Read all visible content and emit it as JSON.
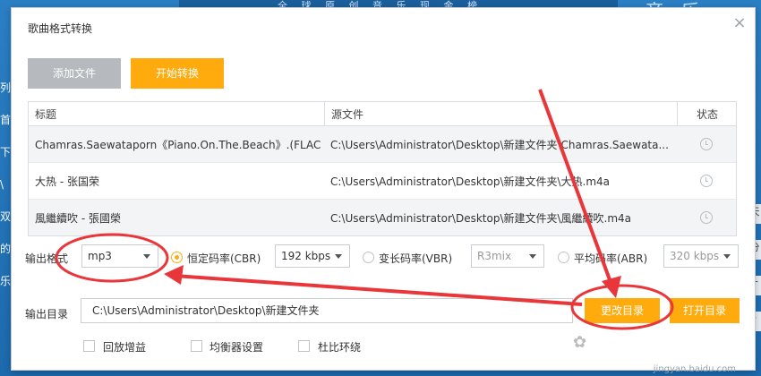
{
  "background": {
    "banner_text": "全 球 原 创 音 乐 现 金 榜",
    "brand_text": "音乐",
    "left_items": [
      "列",
      "首",
      "下",
      "\\",
      "双",
      "的",
      "乐"
    ],
    "right_items": [
      "天",
      "分",
      "+",
      "-"
    ]
  },
  "dialog": {
    "title": "歌曲格式转换",
    "close_icon": "×",
    "add_file_label": "添加文件",
    "start_label": "开始转换"
  },
  "table": {
    "headers": {
      "title": "标题",
      "source": "源文件",
      "status": "状态"
    },
    "rows": [
      {
        "title": "Chamras.Saewataporn《Piano.On.The.Beach》.(FLAC)",
        "source": "C:\\Users\\Administrator\\Desktop\\新建文件夹\\Chamras.Saewata..."
      },
      {
        "title": "大热 - 张国荣",
        "source": "C:\\Users\\Administrator\\Desktop\\新建文件夹\\大热.m4a"
      },
      {
        "title": "風繼續吹 - 張國榮",
        "source": "C:\\Users\\Administrator\\Desktop\\新建文件夹\\風繼續吹.m4a"
      }
    ]
  },
  "format": {
    "label": "输出格式",
    "value": "mp3",
    "cbr_label": "恒定码率(CBR)",
    "cbr_value": "192 kbps",
    "vbr_label": "变长码率(VBR)",
    "vbr_value": "R3mix",
    "abr_label": "平均码率(ABR)",
    "abr_value": "320 kbps",
    "selected_mode": "CBR"
  },
  "output": {
    "label": "输出目录",
    "path": "C:\\Users\\Administrator\\Desktop\\新建文件夹",
    "change_label": "更改目录",
    "open_label": "打开目录"
  },
  "options": {
    "replay_gain": "回放增益",
    "equalizer": "均衡器设置",
    "dolby": "杜比环绕"
  },
  "watermark": "jingyan.baidu.com",
  "colors": {
    "accent": "#ffab0d",
    "disabled_button": "#b6b9bd",
    "annotation": "#e8363a"
  }
}
